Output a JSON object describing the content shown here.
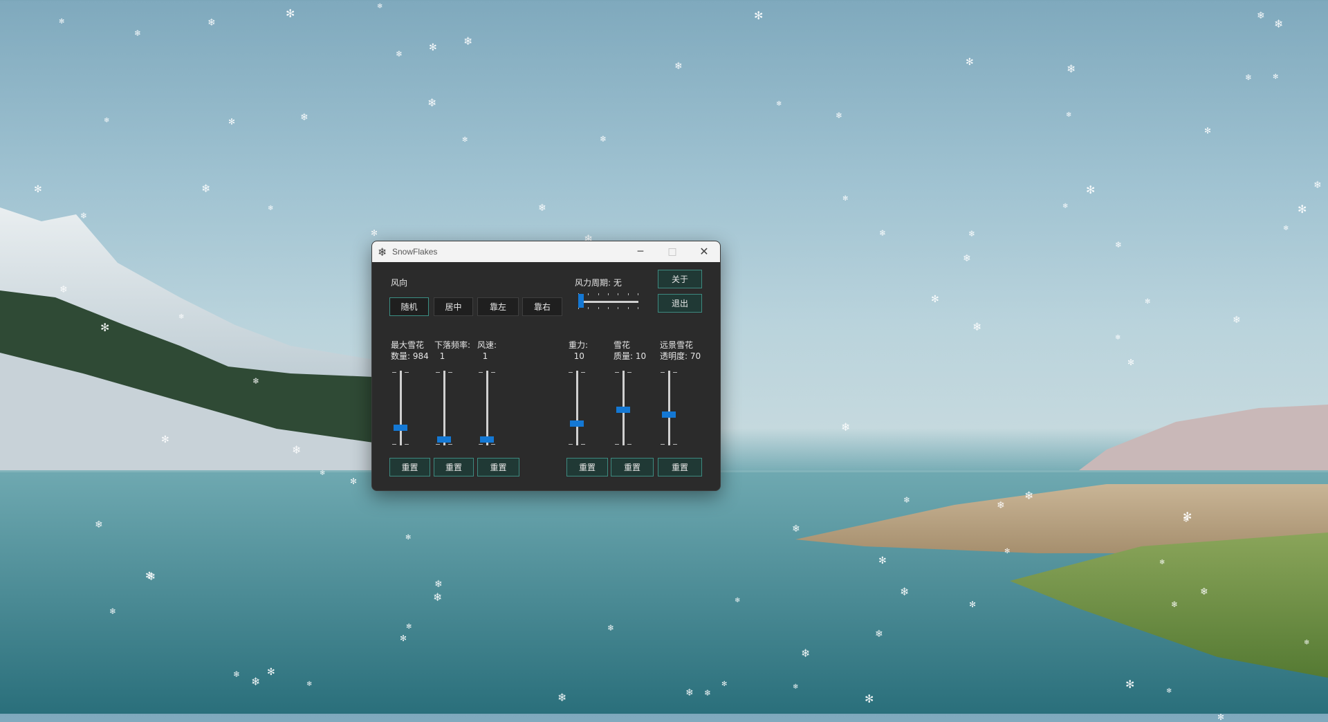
{
  "window": {
    "title": "SnowFlakes",
    "app_icon": "snowflake-icon",
    "minimize_glyph": "─",
    "maximize_glyph": "□",
    "close_glyph": "✕"
  },
  "wind_direction": {
    "label": "风向",
    "buttons": [
      "随机",
      "居中",
      "靠左",
      "靠右"
    ],
    "selected": "随机"
  },
  "wind_period": {
    "label": "风力周期: 无",
    "value_fraction": 0.0
  },
  "actions": {
    "about": "关于",
    "exit": "退出"
  },
  "sliders": [
    {
      "label_line1": "最大雪花",
      "label_line2": "数量: 984",
      "value_fraction": 0.22
    },
    {
      "label_line1": "下落频率:",
      "label_line2": "  1",
      "value_fraction": 0.05
    },
    {
      "label_line1": "风速:",
      "label_line2": "  1",
      "value_fraction": 0.05
    },
    {
      "label_line1": "重力:",
      "label_line2": "  10",
      "value_fraction": 0.28
    },
    {
      "label_line1": "雪花",
      "label_line2": "质量: 10",
      "value_fraction": 0.48
    },
    {
      "label_line1": "远景雪花",
      "label_line2": "透明度: 70",
      "value_fraction": 0.41
    }
  ],
  "reset_label": "重置",
  "colors": {
    "accent": "#1478d4",
    "teal_border": "#3e8a80",
    "window_bg": "#2b2b2b"
  }
}
